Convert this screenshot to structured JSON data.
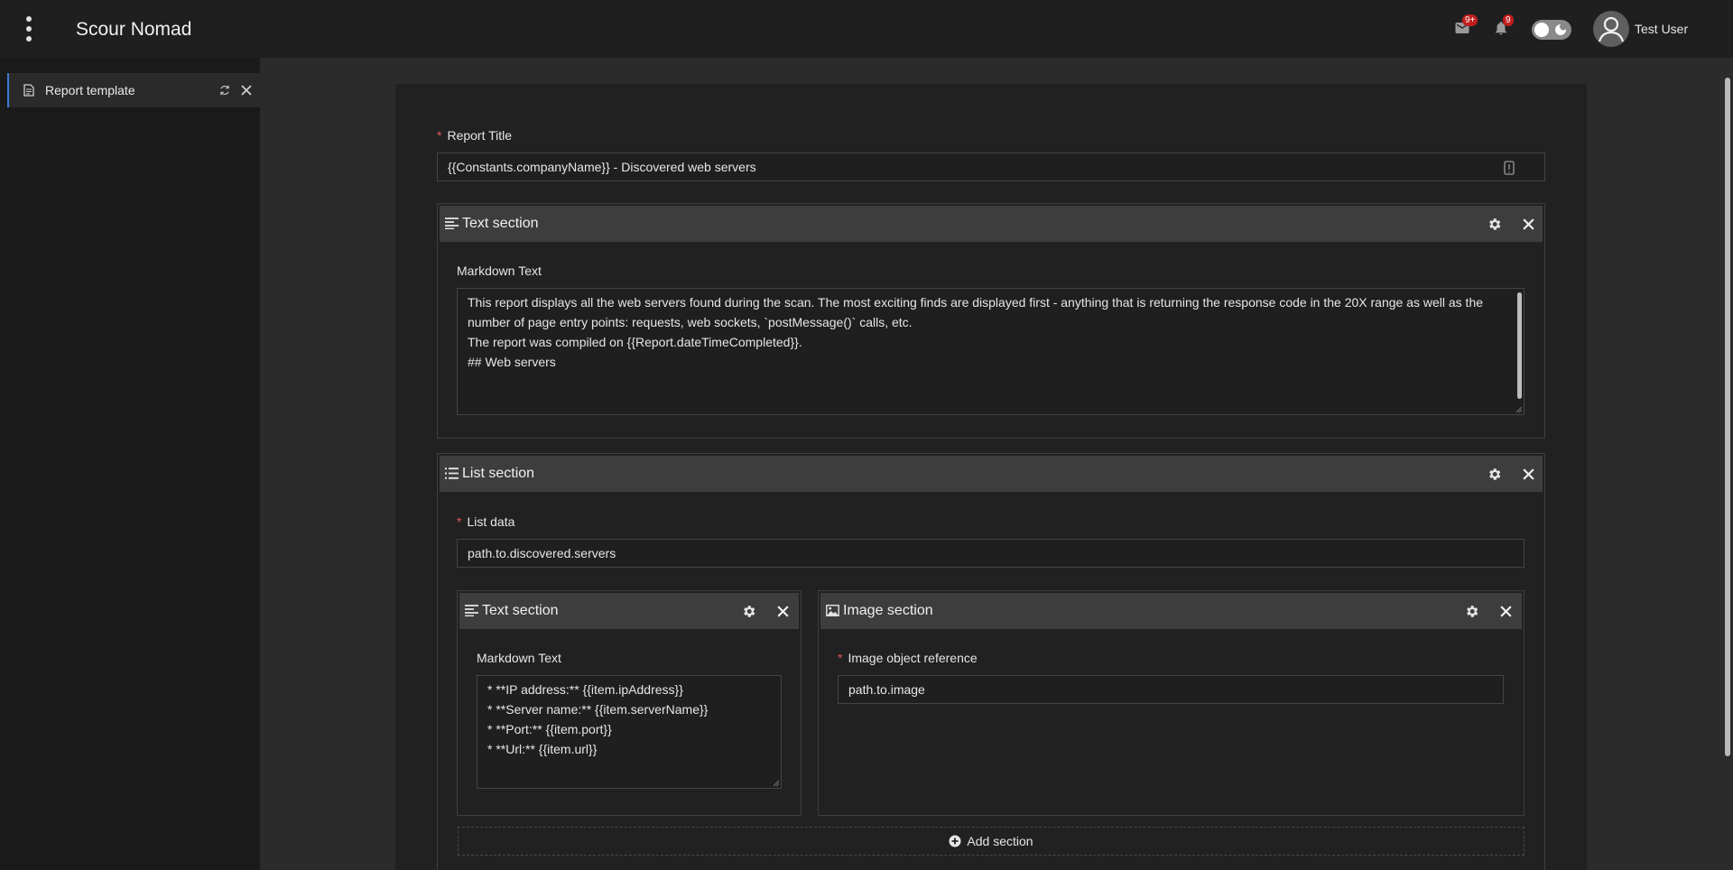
{
  "app": {
    "title": "Scour Nomad"
  },
  "header": {
    "mail_badge": "9+",
    "notif_badge": "9",
    "user_name": "Test User"
  },
  "sidebar": {
    "tabs": [
      {
        "label": "Report template"
      }
    ]
  },
  "form": {
    "report_title_label": "Report Title",
    "report_title_value": "{{Constants.companyName}} - Discovered web servers",
    "text_section": {
      "title": "Text section",
      "markdown_label": "Markdown Text",
      "markdown_lines": [
        "This report displays all the web servers found during the scan. The most exciting finds are displayed first - anything that is returning the response code in the 20X range as well as the",
        "number of page entry points: requests, web sockets, `postMessage()` calls, etc.",
        "",
        "The report was compiled on {{Report.dateTimeCompleted}}.",
        "",
        "## Web servers"
      ]
    },
    "list_section": {
      "title": "List section",
      "list_data_label": "List data",
      "list_data_value": "path.to.discovered.servers",
      "inner_text_section": {
        "title": "Text section",
        "markdown_label": "Markdown Text",
        "markdown_lines": [
          "* **IP address:** {{item.ipAddress}}",
          "* **Server name:** {{item.serverName}}",
          "* **Port:** {{item.port}}",
          "* **Url:** {{item.url}}"
        ]
      },
      "image_section": {
        "title": "Image section",
        "ref_label": "Image object reference",
        "ref_value": "path.to.image"
      },
      "add_section_label": "Add section"
    }
  },
  "colors": {
    "accent": "#3a7bd5",
    "required": "#e05757",
    "badge": "#c01e1e"
  }
}
